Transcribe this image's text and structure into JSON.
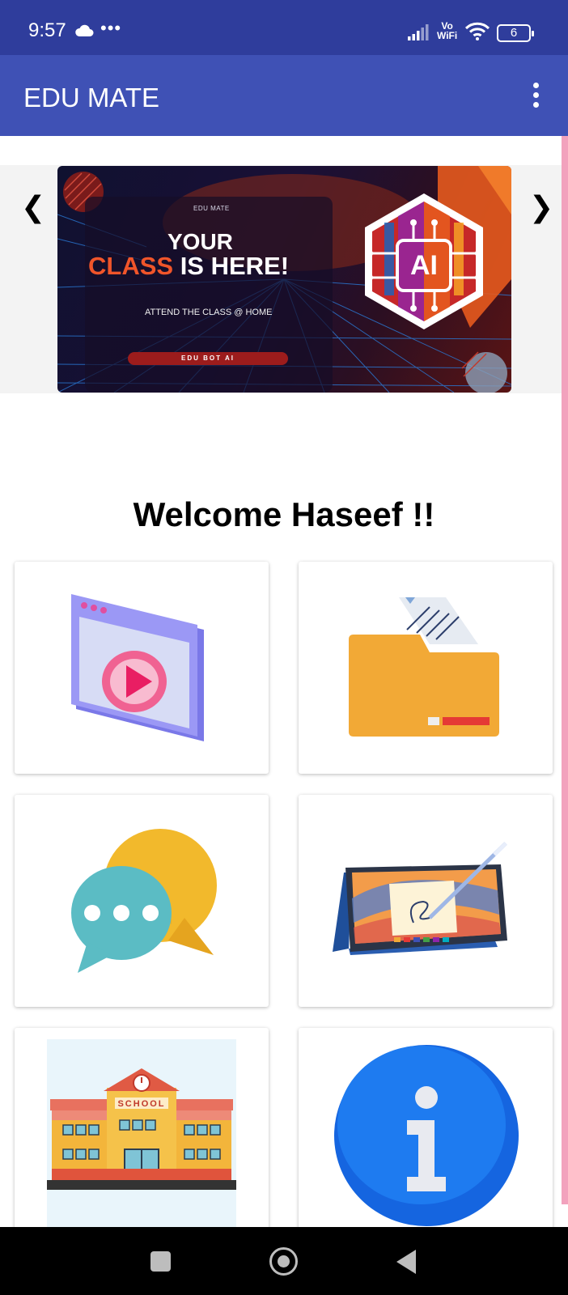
{
  "status_bar": {
    "time": "9:57",
    "more": "•••",
    "vo": "Vo",
    "wifi_label": "WiFi",
    "battery": "6"
  },
  "app_bar": {
    "title": "EDU MATE"
  },
  "carousel": {
    "prev": "❮",
    "next": "❯",
    "banner": {
      "brand": "EDU MATE",
      "headline_top": "YOUR",
      "headline_accent": "CLASS",
      "headline_rest": " IS HERE!",
      "tagline": "ATTEND THE CLASS @ HOME",
      "pill": "EDU BOT AI",
      "badge": "AI"
    }
  },
  "welcome": "Welcome Haseef !!",
  "tiles": [
    {
      "icon": "video-player-icon"
    },
    {
      "icon": "folder-icon"
    },
    {
      "icon": "chat-icon"
    },
    {
      "icon": "tablet-icon"
    },
    {
      "icon": "school-icon",
      "sign": "SCHOOL"
    },
    {
      "icon": "info-icon"
    }
  ],
  "colors": {
    "status_bar": "#2f3d9c",
    "app_bar": "#3f51b5",
    "accent": "#f0552a"
  }
}
